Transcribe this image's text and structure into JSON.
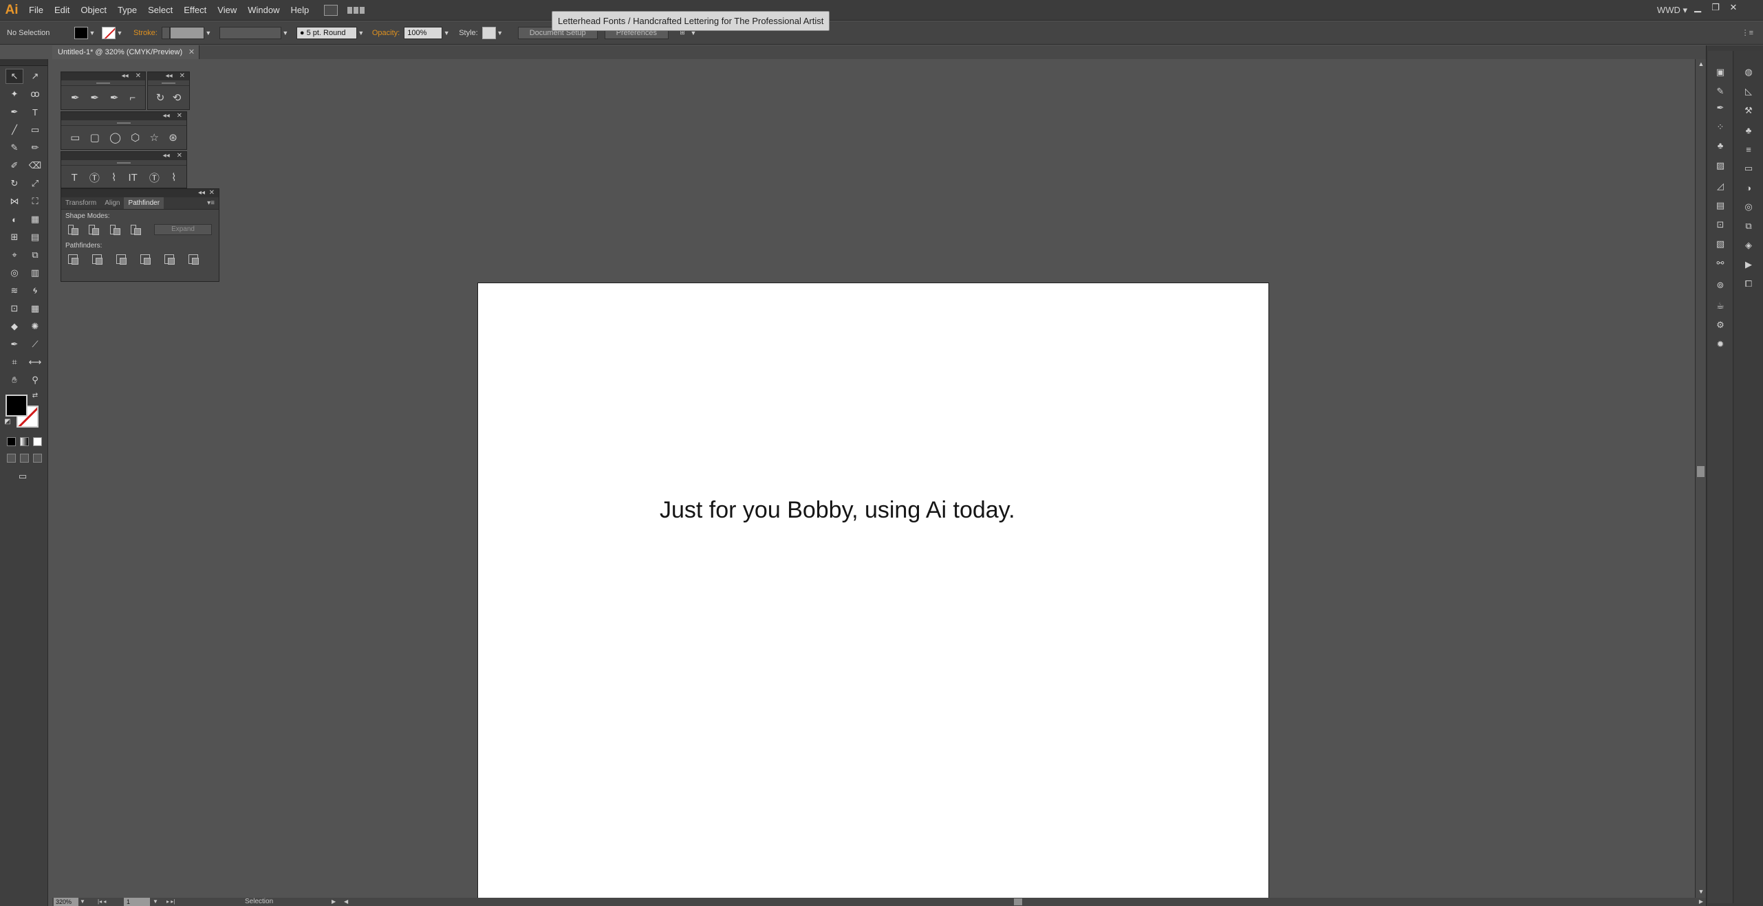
{
  "app": {
    "logo": "Ai",
    "menus": [
      "File",
      "Edit",
      "Object",
      "Type",
      "Select",
      "Effect",
      "View",
      "Window",
      "Help"
    ],
    "workspace": "WWD",
    "tooltip": "Letterhead Fonts / Handcrafted Lettering for The Professional Artist"
  },
  "control_bar": {
    "selection_label": "No Selection",
    "stroke_label": "Stroke:",
    "brush_value": "5 pt. Round",
    "opacity_label": "Opacity:",
    "opacity_value": "100%",
    "style_label": "Style:",
    "document_setup": "Document Setup",
    "preferences": "Preferences"
  },
  "document": {
    "tab_title": "Untitled-1* @ 320% (CMYK/Preview)",
    "artboard_text": "Just for you Bobby, using Ai today."
  },
  "pathfinder_panel": {
    "tabs": [
      "Transform",
      "Align",
      "Pathfinder"
    ],
    "active_tab": "Pathfinder",
    "shape_modes_label": "Shape Modes:",
    "pathfinders_label": "Pathfinders:",
    "expand_label": "Expand"
  },
  "status_bar": {
    "zoom": "320%",
    "page": "1",
    "tool": "Selection"
  },
  "colors": {
    "accent": "#e8962a",
    "none_slash": "#d21c1c"
  }
}
